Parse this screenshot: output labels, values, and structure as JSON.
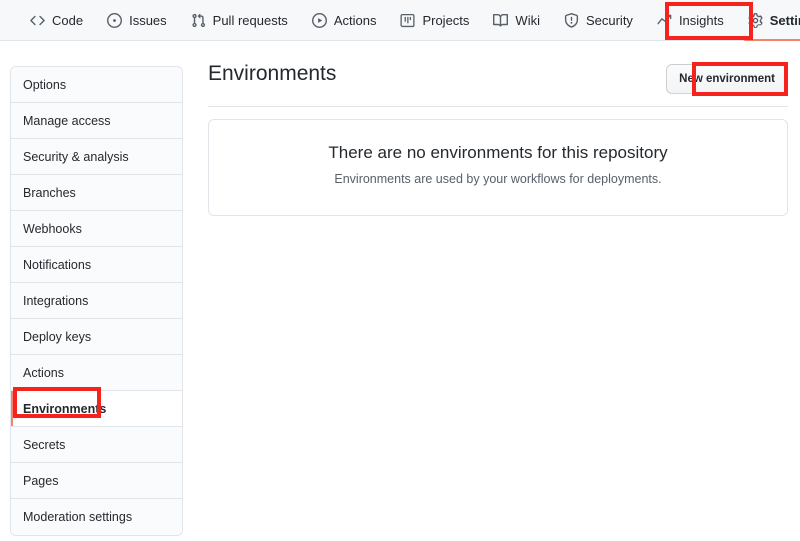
{
  "repo_nav": {
    "items": [
      {
        "label": "Code",
        "icon": "code-icon",
        "selected": false
      },
      {
        "label": "Issues",
        "icon": "issue-opened-icon",
        "selected": false
      },
      {
        "label": "Pull requests",
        "icon": "git-pull-request-icon",
        "selected": false
      },
      {
        "label": "Actions",
        "icon": "play-icon",
        "selected": false
      },
      {
        "label": "Projects",
        "icon": "project-icon",
        "selected": false
      },
      {
        "label": "Wiki",
        "icon": "book-icon",
        "selected": false
      },
      {
        "label": "Security",
        "icon": "shield-icon",
        "selected": false
      },
      {
        "label": "Insights",
        "icon": "graph-icon",
        "selected": false
      },
      {
        "label": "Settings",
        "icon": "gear-icon",
        "selected": true
      }
    ]
  },
  "sidebar": {
    "items": [
      {
        "label": "Options",
        "selected": false
      },
      {
        "label": "Manage access",
        "selected": false
      },
      {
        "label": "Security & analysis",
        "selected": false
      },
      {
        "label": "Branches",
        "selected": false
      },
      {
        "label": "Webhooks",
        "selected": false
      },
      {
        "label": "Notifications",
        "selected": false
      },
      {
        "label": "Integrations",
        "selected": false
      },
      {
        "label": "Deploy keys",
        "selected": false
      },
      {
        "label": "Actions",
        "selected": false
      },
      {
        "label": "Environments",
        "selected": true
      },
      {
        "label": "Secrets",
        "selected": false
      },
      {
        "label": "Pages",
        "selected": false
      },
      {
        "label": "Moderation settings",
        "selected": false
      }
    ]
  },
  "main": {
    "title": "Environments",
    "new_environment_button": "New environment",
    "empty_state": {
      "title": "There are no environments for this repository",
      "subtitle": "Environments are used by your workflows for deployments."
    }
  },
  "annotations": {
    "color": "#f5221e",
    "targets": [
      "Settings",
      "New environment",
      "Environments"
    ]
  },
  "colors": {
    "accent_underline": "#f9826c",
    "nav_background": "#f6f8fa",
    "border": "#e1e4e8",
    "text_primary": "#24292e",
    "text_muted": "#586069"
  }
}
